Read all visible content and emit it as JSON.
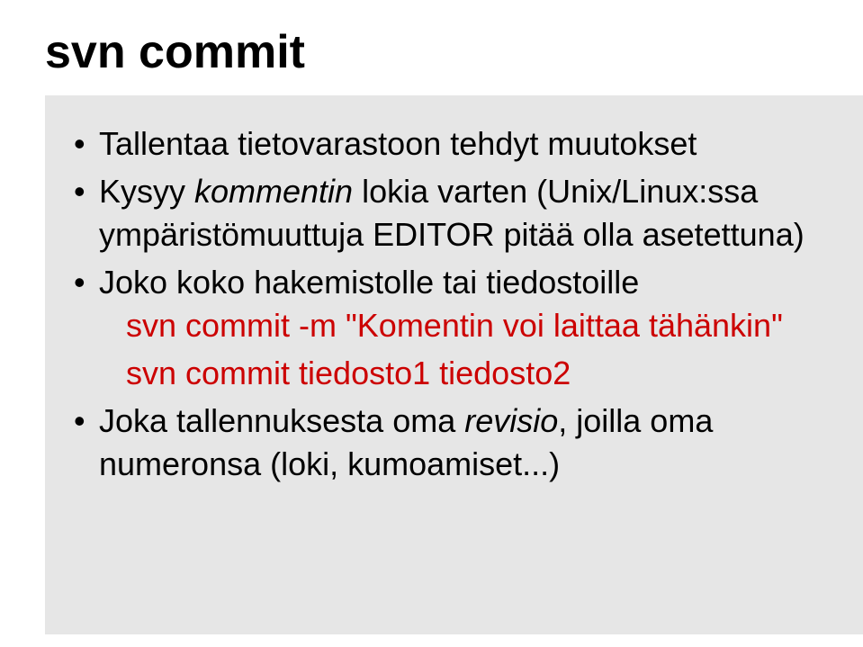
{
  "title": "svn commit",
  "bullets": [
    {
      "text_before": "Tallentaa tietovarastoon tehdyt muutokset"
    },
    {
      "text_before": "Kysyy ",
      "italic_part": "kommentin",
      "text_after": " lokia varten (Unix/Linux:ssa ympäristömuuttuja EDITOR pitää olla asetettuna)"
    },
    {
      "text_before": "Joko koko hakemistolle tai tiedostoille",
      "sub_lines": [
        "svn commit -m \"Komentin voi laittaa tähänkin\"",
        "svn commit tiedosto1 tiedosto2"
      ]
    },
    {
      "text_before": "Joka tallennuksesta oma ",
      "italic_part": "revisio",
      "text_after": ", joilla oma numeronsa (loki, kumoamiset...)"
    }
  ]
}
